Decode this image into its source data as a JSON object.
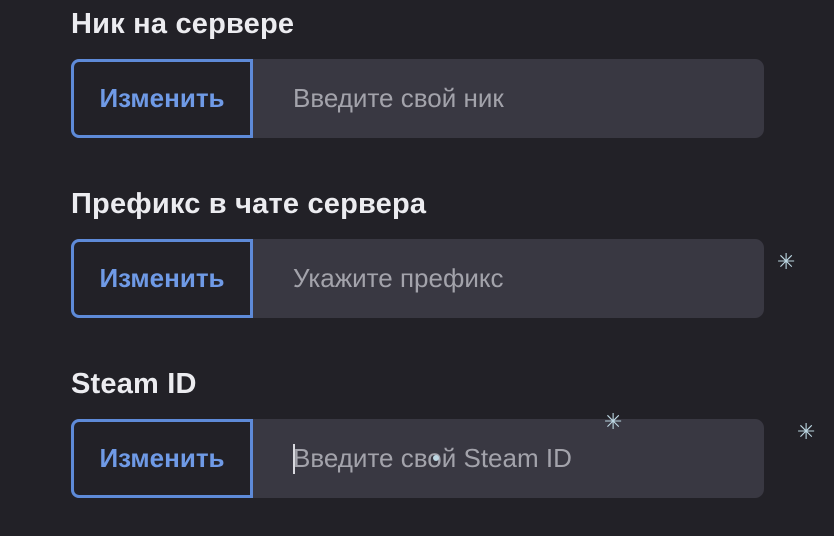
{
  "fields": [
    {
      "label": "Ник на сервере",
      "button_label": "Изменить",
      "placeholder": "Введите свой ник",
      "value": ""
    },
    {
      "label": "Префикс в чате сервера",
      "button_label": "Изменить",
      "placeholder": "Укажите префикс",
      "value": ""
    },
    {
      "label": "Steam ID",
      "button_label": "Изменить",
      "placeholder": "Введите свой Steam ID",
      "value": ""
    }
  ],
  "decorations": {
    "sparkle_glyph": "✳",
    "sparkle_icon": "snowflake-sparkle-icon"
  },
  "colors": {
    "background": "#222127",
    "input_background": "#393842",
    "button_border": "#5e8ad8",
    "button_text": "#6f9ae6",
    "label_text": "#ececf0",
    "placeholder_text": "#a3a3ab"
  }
}
